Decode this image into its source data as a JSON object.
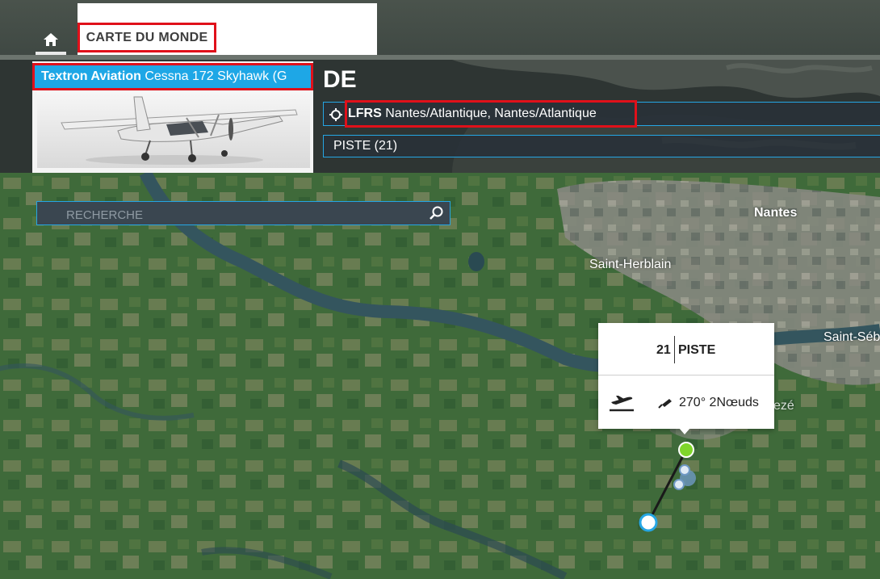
{
  "nav": {
    "home_icon": "home-icon",
    "tab_world_map": "CARTE DU MONDE"
  },
  "departure": {
    "label": "DE",
    "aircraft": {
      "manufacturer": "Textron Aviation",
      "model": "Cessna 172 Skyhawk (G"
    },
    "airport": {
      "icao": "LFRS",
      "name": "Nantes/Atlantique, Nantes/Atlantique"
    },
    "runway": "PISTE (21)"
  },
  "search": {
    "placeholder": "RECHERCHE"
  },
  "map": {
    "cities": {
      "nantes": "Nantes",
      "saint_herblain": "Saint-Herblain",
      "saint_seb": "Saint-Séb",
      "reze": "ezé"
    }
  },
  "runway_popup": {
    "number": "21",
    "label": "PISTE",
    "wind": "270° 2Nœuds"
  },
  "colors": {
    "accent_blue": "#25a6e4",
    "highlight_red": "#e0101a",
    "route_green": "#7fd62a"
  }
}
